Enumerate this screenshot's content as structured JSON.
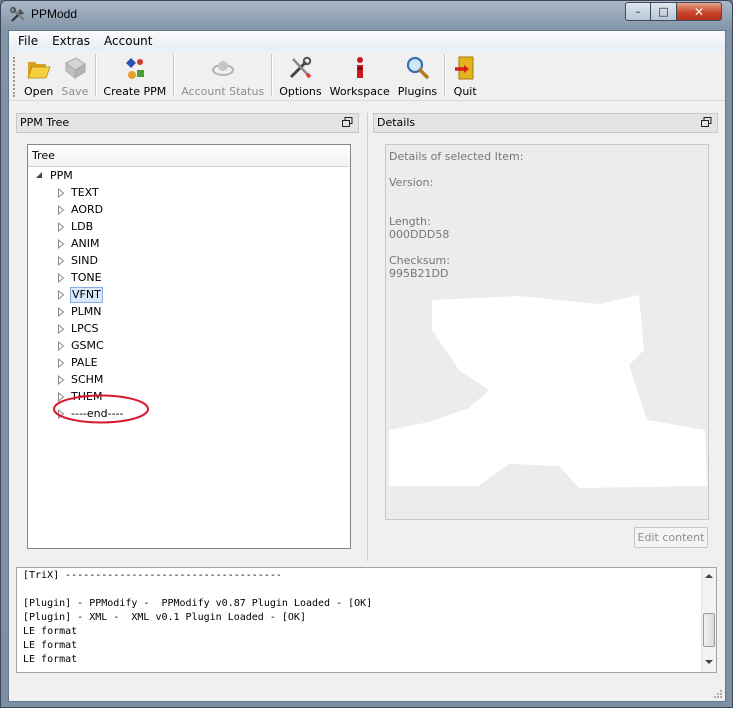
{
  "window": {
    "title": "PPModd",
    "controls": {
      "minimize": "–",
      "maximize": "□",
      "close": "✕"
    }
  },
  "menubar": {
    "items": [
      {
        "label": "File"
      },
      {
        "label": "Extras"
      },
      {
        "label": "Account"
      }
    ]
  },
  "toolbar": {
    "open_label": "Open",
    "save_label": "Save",
    "create_ppm_label": "Create PPM",
    "account_status_label": "Account Status",
    "options_label": "Options",
    "workspace_label": "Workspace",
    "plugins_label": "Plugins",
    "quit_label": "Quit"
  },
  "ppm_tree_dock": {
    "title": "PPM Tree",
    "header": "Tree",
    "root": "PPM",
    "items": [
      {
        "label": "TEXT"
      },
      {
        "label": "AORD"
      },
      {
        "label": "LDB"
      },
      {
        "label": "ANIM"
      },
      {
        "label": "SIND"
      },
      {
        "label": "TONE"
      },
      {
        "label": "VFNT"
      },
      {
        "label": "PLMN"
      },
      {
        "label": "LPCS"
      },
      {
        "label": "GSMC"
      },
      {
        "label": "PALE"
      },
      {
        "label": "SCHM"
      },
      {
        "label": "THEM"
      },
      {
        "label": "----end----"
      }
    ],
    "selected": "VFNT"
  },
  "details_dock": {
    "title": "Details",
    "heading": "Details of selected Item:",
    "version_label": "Version:",
    "length_label": "Length:",
    "length_value": "000DDD58",
    "checksum_label": "Checksum:",
    "checksum_value": "995B21DD",
    "edit_button": "Edit content"
  },
  "log": {
    "lines": [
      "[TriX] ------------------------------------",
      "",
      "[Plugin] - PPModify -  PPModify v0.87 Plugin Loaded - [OK]",
      "[Plugin] - XML -  XML v0.1 Plugin Loaded - [OK]",
      "LE format",
      "LE format",
      "LE format"
    ]
  },
  "colors": {
    "highlight_ellipse": "#d8182a",
    "selection_fill": "#d9e8fb",
    "close_button": "#c9452c"
  }
}
